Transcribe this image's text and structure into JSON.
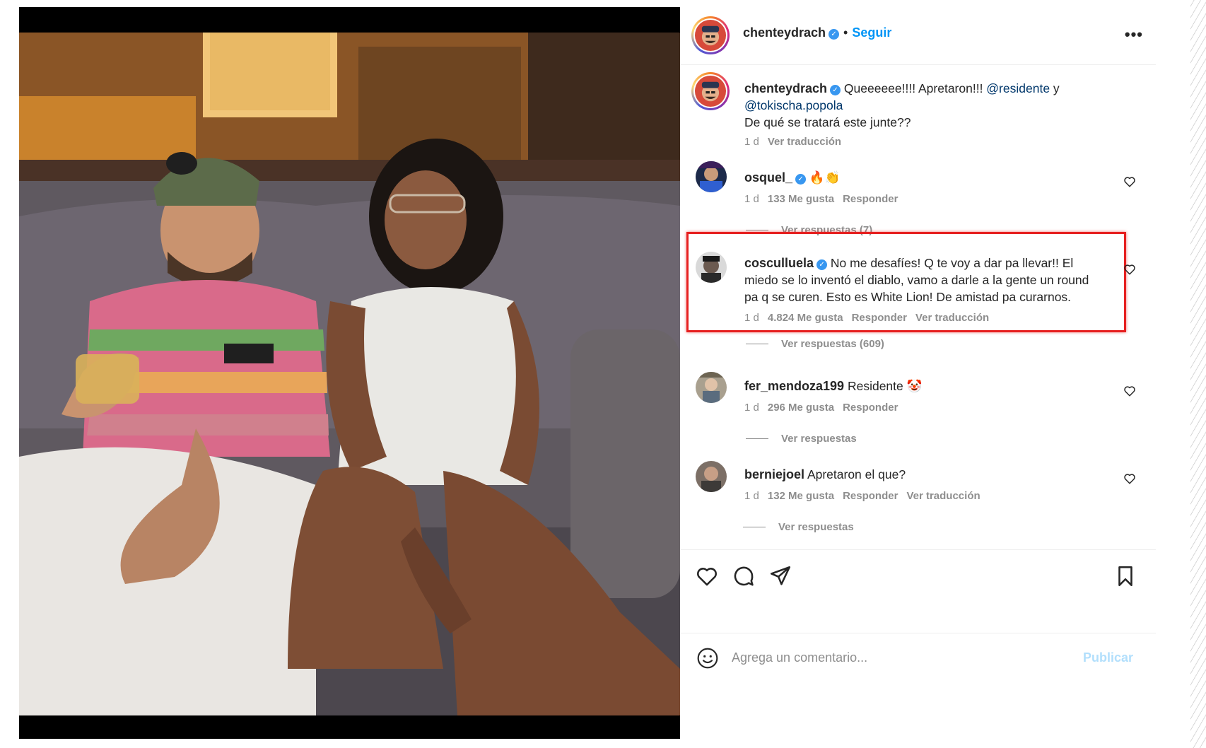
{
  "post": {
    "author": "chenteydrach",
    "follow_label": "Seguir",
    "dot": "•",
    "more_label": "•••"
  },
  "caption": {
    "username": "chenteydrach",
    "text_before": " Queeeeee!!!! Apretaron!!! ",
    "mention1": "@residente",
    "text_mid": " y ",
    "mention2": "@tokischa.popola",
    "text_after": "De qué se tratará este junte??",
    "time": "1 d",
    "translate": "Ver traducción"
  },
  "comments": [
    {
      "username": "osquel_",
      "verified": true,
      "text": "🔥👏",
      "time": "1 d",
      "likes": "133 Me gusta",
      "reply": "Responder",
      "translate": "",
      "replies": "Ver respuestas (7)"
    },
    {
      "username": "cosculluela",
      "verified": true,
      "text": "No me desafíes! Q te voy a dar pa llevar!! El miedo se lo inventó el diablo, vamo a darle a la gente un round pa q se curen. Esto es White Lion! De amistad pa curarnos.",
      "time": "1 d",
      "likes": "4.824 Me gusta",
      "reply": "Responder",
      "translate": "Ver traducción",
      "replies": "Ver respuestas (609)"
    },
    {
      "username": "fer_mendoza199",
      "verified": false,
      "text": "Residente 🤡",
      "time": "1 d",
      "likes": "296 Me gusta",
      "reply": "Responder",
      "translate": "",
      "replies": "Ver respuestas"
    },
    {
      "username": "berniejoel",
      "verified": false,
      "text": "Apretaron el que?",
      "time": "1 d",
      "likes": "132 Me gusta",
      "reply": "Responder",
      "translate": "Ver traducción",
      "replies": "Ver respuestas"
    }
  ],
  "actions": {
    "like_icon": "heart-icon",
    "comment_icon": "comment-icon",
    "share_icon": "send-icon",
    "save_icon": "bookmark-icon"
  },
  "add_comment": {
    "placeholder": "Agrega un comentario...",
    "publish": "Publicar"
  },
  "colors": {
    "link": "#0095f6",
    "verified": "#3897f0",
    "highlight": "#e62020",
    "publish_disabled": "#b2dffc"
  }
}
